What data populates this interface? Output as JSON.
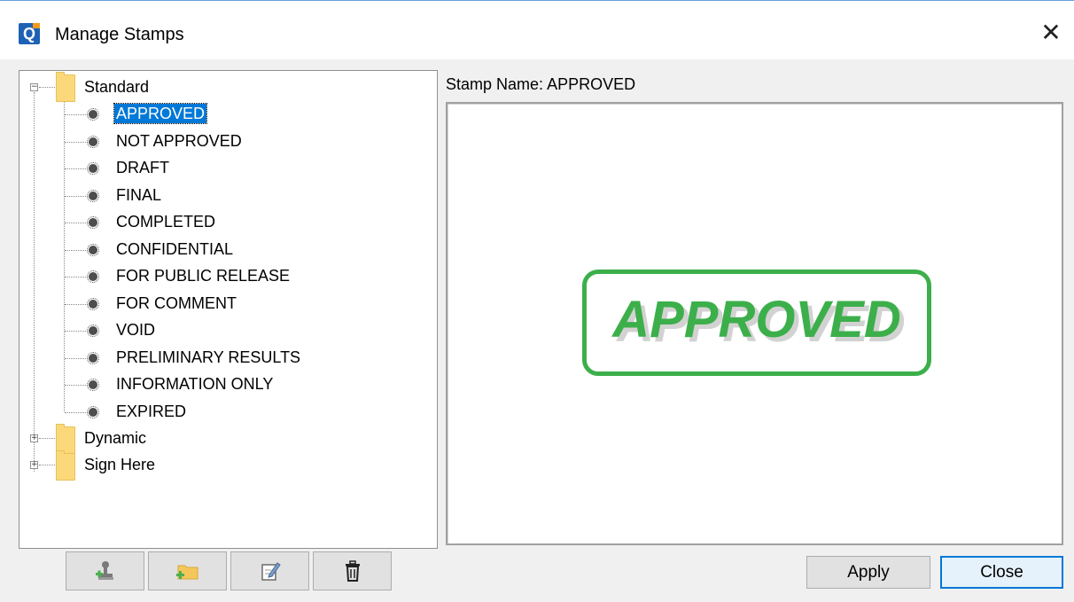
{
  "window": {
    "title": "Manage Stamps",
    "app_icon_letter": "Q",
    "close_glyph": "✕"
  },
  "tree": {
    "groups": [
      {
        "label": "Standard",
        "expander": "−",
        "items": [
          "APPROVED",
          "NOT APPROVED",
          "DRAFT",
          "FINAL",
          "COMPLETED",
          "CONFIDENTIAL",
          "FOR PUBLIC RELEASE",
          "FOR COMMENT",
          "VOID",
          "PRELIMINARY RESULTS",
          "INFORMATION ONLY",
          "EXPIRED"
        ]
      },
      {
        "label": "Dynamic",
        "expander": "+"
      },
      {
        "label": "Sign Here",
        "expander": "+"
      }
    ],
    "selected_item": "APPROVED"
  },
  "preview": {
    "stamp_name_label": "Stamp Name:",
    "stamp_name_value": "APPROVED",
    "stamp_text": "APPROVED",
    "stamp_color": "#3caf4b"
  },
  "toolbar": {
    "icons": [
      "add-stamp-icon",
      "add-folder-icon",
      "edit-icon",
      "delete-icon"
    ]
  },
  "buttons": {
    "apply": "Apply",
    "close": "Close"
  },
  "colors": {
    "selection": "#0078d7",
    "folder": "#fbd97a"
  }
}
